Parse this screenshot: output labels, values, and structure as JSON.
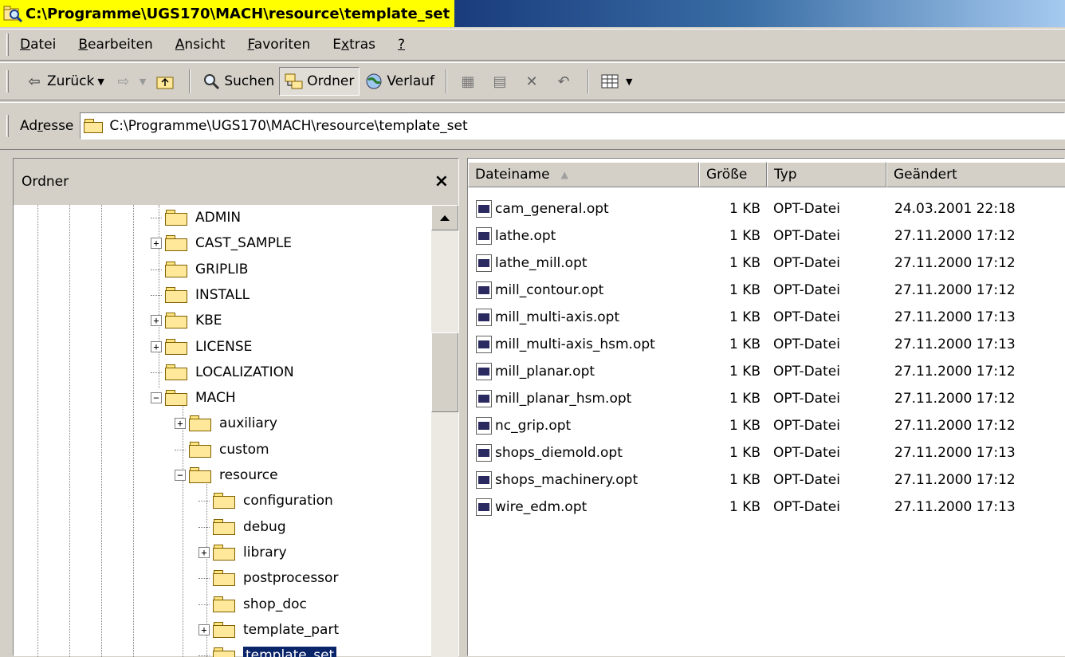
{
  "window": {
    "title": "C:\\Programme\\UGS170\\MACH\\resource\\template_set"
  },
  "menu": {
    "items": [
      {
        "label": "Datei",
        "u": "D",
        "rest": "atei"
      },
      {
        "label": "Bearbeiten",
        "u": "B",
        "rest": "earbeiten"
      },
      {
        "label": "Ansicht",
        "u": "A",
        "rest": "nsicht"
      },
      {
        "label": "Favoriten",
        "u": "F",
        "rest": "avoriten"
      },
      {
        "label": "Extras",
        "pre": "E",
        "u": "x",
        "rest": "tras"
      },
      {
        "label": "?",
        "u": "?",
        "rest": ""
      }
    ]
  },
  "toolbar": {
    "back_label": "Zurück",
    "search_label": "Suchen",
    "folders_label": "Ordner",
    "history_label": "Verlauf"
  },
  "address": {
    "label_pre": "Ad",
    "label_u": "r",
    "label_post": "esse",
    "value": "C:\\Programme\\UGS170\\MACH\\resource\\template_set"
  },
  "folders_panel": {
    "title": "Ordner",
    "close": "×",
    "tree": [
      {
        "label": "ADMIN",
        "level": 0,
        "expander": ""
      },
      {
        "label": "CAST_SAMPLE",
        "level": 0,
        "expander": "+"
      },
      {
        "label": "GRIPLIB",
        "level": 0,
        "expander": ""
      },
      {
        "label": "INSTALL",
        "level": 0,
        "expander": ""
      },
      {
        "label": "KBE",
        "level": 0,
        "expander": "+"
      },
      {
        "label": "LICENSE",
        "level": 0,
        "expander": "+"
      },
      {
        "label": "LOCALIZATION",
        "level": 0,
        "expander": ""
      },
      {
        "label": "MACH",
        "level": 0,
        "expander": "-"
      },
      {
        "label": "auxiliary",
        "level": 1,
        "expander": "+"
      },
      {
        "label": "custom",
        "level": 1,
        "expander": ""
      },
      {
        "label": "resource",
        "level": 1,
        "expander": "-"
      },
      {
        "label": "configuration",
        "level": 2,
        "expander": ""
      },
      {
        "label": "debug",
        "level": 2,
        "expander": ""
      },
      {
        "label": "library",
        "level": 2,
        "expander": "+"
      },
      {
        "label": "postprocessor",
        "level": 2,
        "expander": ""
      },
      {
        "label": "shop_doc",
        "level": 2,
        "expander": ""
      },
      {
        "label": "template_part",
        "level": 2,
        "expander": "+"
      },
      {
        "label": "template_set",
        "level": 2,
        "expander": "",
        "selected": true
      }
    ]
  },
  "file_list": {
    "columns": [
      "Dateiname",
      "Größe",
      "Typ",
      "Geändert"
    ],
    "rows": [
      {
        "name": "cam_general.opt",
        "size": "1 KB",
        "type": "OPT-Datei",
        "modified": "24.03.2001 22:18"
      },
      {
        "name": "lathe.opt",
        "size": "1 KB",
        "type": "OPT-Datei",
        "modified": "27.11.2000 17:12"
      },
      {
        "name": "lathe_mill.opt",
        "size": "1 KB",
        "type": "OPT-Datei",
        "modified": "27.11.2000 17:12"
      },
      {
        "name": "mill_contour.opt",
        "size": "1 KB",
        "type": "OPT-Datei",
        "modified": "27.11.2000 17:12"
      },
      {
        "name": "mill_multi-axis.opt",
        "size": "1 KB",
        "type": "OPT-Datei",
        "modified": "27.11.2000 17:13"
      },
      {
        "name": "mill_multi-axis_hsm.opt",
        "size": "1 KB",
        "type": "OPT-Datei",
        "modified": "27.11.2000 17:13"
      },
      {
        "name": "mill_planar.opt",
        "size": "1 KB",
        "type": "OPT-Datei",
        "modified": "27.11.2000 17:12"
      },
      {
        "name": "mill_planar_hsm.opt",
        "size": "1 KB",
        "type": "OPT-Datei",
        "modified": "27.11.2000 17:12"
      },
      {
        "name": "nc_grip.opt",
        "size": "1 KB",
        "type": "OPT-Datei",
        "modified": "27.11.2000 17:12"
      },
      {
        "name": "shops_diemold.opt",
        "size": "1 KB",
        "type": "OPT-Datei",
        "modified": "27.11.2000 17:13"
      },
      {
        "name": "shops_machinery.opt",
        "size": "1 KB",
        "type": "OPT-Datei",
        "modified": "27.11.2000 17:12"
      },
      {
        "name": "wire_edm.opt",
        "size": "1 KB",
        "type": "OPT-Datei",
        "modified": "27.11.2000 17:13"
      }
    ]
  },
  "colors": {
    "title_highlight": "#ffff00",
    "selection": "#0a246a",
    "face": "#d4d0c8"
  }
}
